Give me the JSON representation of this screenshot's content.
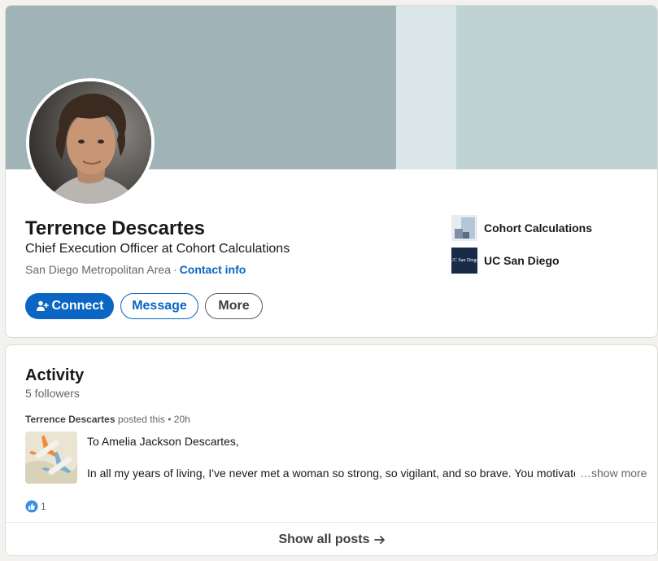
{
  "profile": {
    "name": "Terrence Descartes",
    "headline": "Chief Execution Officer at Cohort Calculations",
    "location": "San Diego Metropolitan Area",
    "separator": "·",
    "contact_label": "Contact info",
    "buttons": {
      "connect": "Connect",
      "message": "Message",
      "more": "More"
    },
    "orgs": [
      {
        "name": "Cohort Calculations",
        "icon": "cohort-logo"
      },
      {
        "name": "UC San Diego",
        "icon": "ucsd-logo",
        "logo_text": "UC San Diego"
      }
    ]
  },
  "activity": {
    "title": "Activity",
    "followers": "5 followers",
    "post": {
      "author": "Terrence Descartes",
      "action": "posted this",
      "time": "• 20h",
      "greeting": "To Amelia Jackson Descartes,",
      "body": "In all my years of living, I've never met a woman so strong, so vigilant, and so brave. You motivate me every day.",
      "show_more": "…show more",
      "reaction_count": "1"
    },
    "show_all": "Show all posts"
  },
  "colors": {
    "accent": "#0a66c2",
    "banner_dark": "#a0b3b6",
    "banner_light": "#bfd2d4"
  }
}
